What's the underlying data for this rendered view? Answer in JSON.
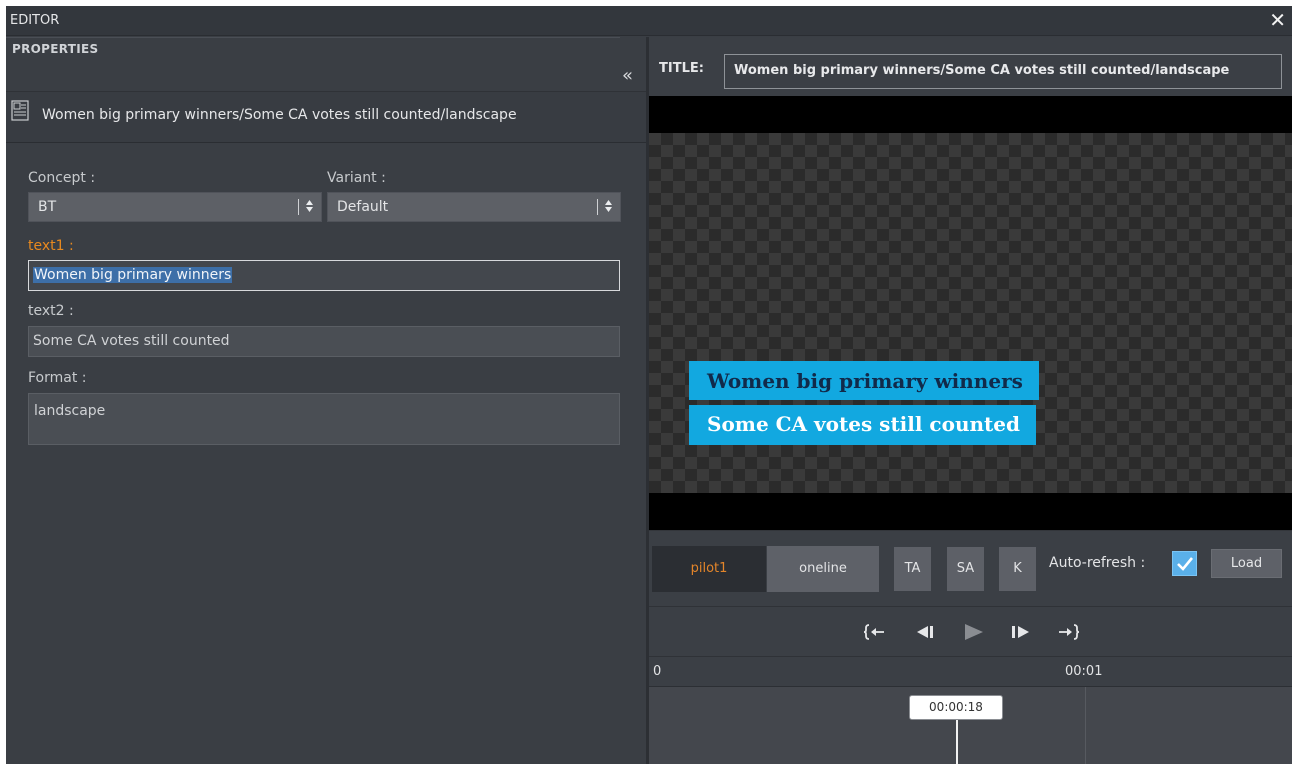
{
  "window": {
    "title": "EDITOR",
    "close_glyph": "✕"
  },
  "properties": {
    "header": "PROPERTIES",
    "collapse_glyph": "«",
    "item_title": "Women big primary winners/Some CA votes still counted/landscape",
    "concept_label": "Concept :",
    "concept_value": "BT",
    "variant_label": "Variant :",
    "variant_value": "Default",
    "select_arrows": "▴\n▾",
    "fields": [
      {
        "label": "text1 :",
        "value": "Women big primary winners",
        "active": true
      },
      {
        "label": "text2 :",
        "value": "Some CA votes still counted",
        "active": false
      }
    ],
    "format_label": "Format :",
    "format_value": "landscape"
  },
  "preview": {
    "title_label": "TITLE:",
    "title_value": "Women big primary winners/Some CA votes still counted/landscape",
    "lower_third_line1": "Women big primary winners",
    "lower_third_line2": "Some CA votes still counted",
    "colors": {
      "lower_third_bg": "#12a8e0",
      "line1_text": "#112a4a",
      "line2_text": "#ffffff"
    }
  },
  "controls": {
    "pilot_tab": "pilot1",
    "oneline_tab": "oneline",
    "ta_button": "TA",
    "sa_button": "SA",
    "k_button": "K",
    "auto_refresh_label": "Auto-refresh :",
    "auto_refresh_checked": true,
    "load_button": "Load"
  },
  "transport": {
    "icons": [
      "go-to-start-icon",
      "step-back-icon",
      "play-icon",
      "step-forward-icon",
      "go-to-end-icon"
    ]
  },
  "timeline": {
    "tick_start": "0",
    "tick_second": "00:01",
    "playhead_time": "00:00:18"
  }
}
